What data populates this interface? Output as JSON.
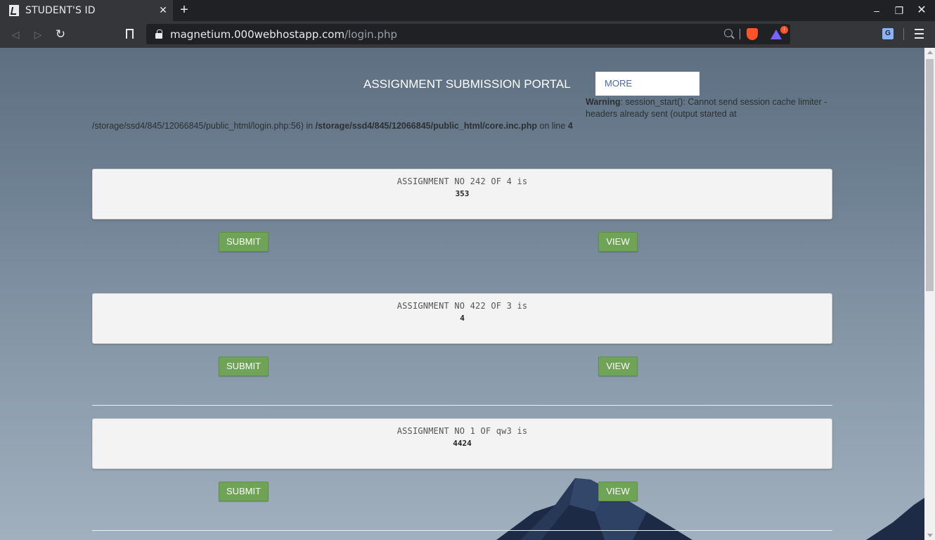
{
  "browser": {
    "tab_title": "STUDENT'S ID",
    "url_host": "magnetium.000webhostapp.com",
    "url_path": "/login.php",
    "rewards_badge": "!",
    "translate_glyph": "G"
  },
  "page": {
    "portal_title": "ASSIGNMENT SUBMISSION PORTAL",
    "more_label": "MORE",
    "warning": {
      "label": "Warning",
      "message": ": session_start(): Cannot send session cache limiter - headers already sent (output started at",
      "cont_path": "/storage/ssd4/845/12066845/public_html/login.php:56) in ",
      "cont_file": "/storage/ssd4/845/12066845/public_html/core.inc.php",
      "cont_online": " on line ",
      "cont_line": "4"
    },
    "assignments": [
      {
        "title": "ASSIGNMENT NO 242 OF 4 is",
        "value": "353",
        "submit": "SUBMIT",
        "view": "VIEW"
      },
      {
        "title": "ASSIGNMENT NO 422 OF 3 is",
        "value": "4",
        "submit": "SUBMIT",
        "view": "VIEW"
      },
      {
        "title": "ASSIGNMENT NO 1 OF qw3 is",
        "value": "4424",
        "submit": "SUBMIT",
        "view": "VIEW"
      }
    ]
  },
  "colors": {
    "button_green": "#6fa457",
    "more_text": "#4a67a8",
    "card_bg": "#f3f3f3"
  },
  "icons": [
    "favicon-icon",
    "close-icon",
    "plus-icon",
    "minimize-icon",
    "restore-icon",
    "back-icon",
    "forward-icon",
    "reload-icon",
    "bookmark-icon",
    "lock-icon",
    "zoom-icon",
    "brave-shield-icon",
    "brave-rewards-icon",
    "translate-icon",
    "menu-icon"
  ]
}
